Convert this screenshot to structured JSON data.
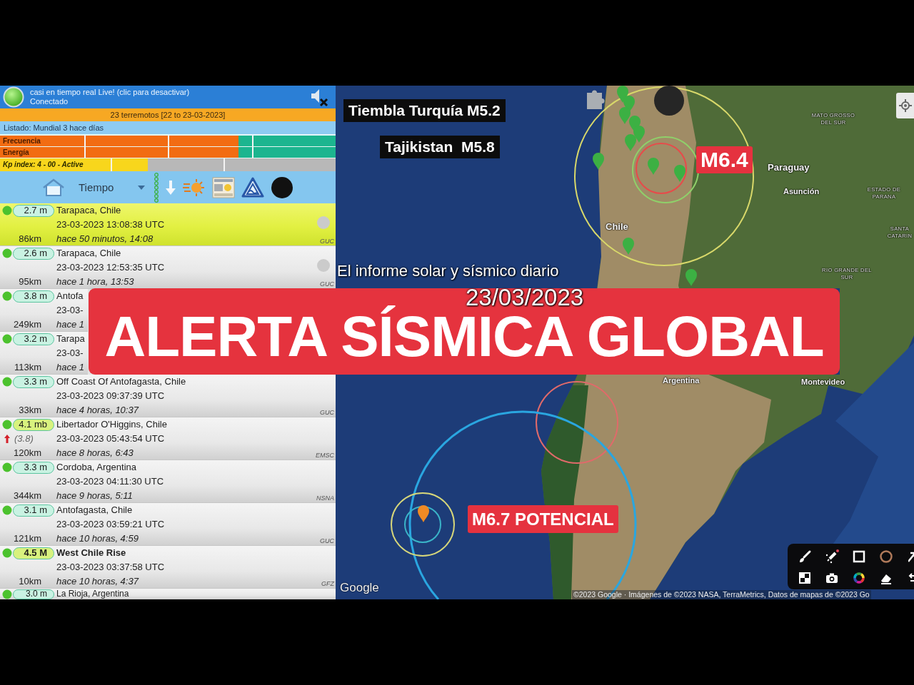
{
  "live_header": {
    "status_text": "casi en tiempo real Live! (clic para desactivar)",
    "connection": "Conectado",
    "connected": true,
    "sound_muted": true
  },
  "summary": "23 terremotos [22 to 23-03-2023]",
  "listing": "Listado: Mundial 3 hace días",
  "meters": [
    {
      "label": "Frecuencia",
      "level": 0.71
    },
    {
      "label": "Energía",
      "level": 0.71
    }
  ],
  "kp_index": {
    "label": "Kp index: 4 - 00 - Active",
    "level": 0.44
  },
  "toolbar": {
    "sort_label": "Tiempo"
  },
  "quakes": [
    {
      "magnitude": "2.7 m",
      "place": "Tarapaca, Chile",
      "time": "23-03-2023 13:08:38 UTC",
      "distance": "86km",
      "ago": "hace 50 minutos, 14:08",
      "source": "GUC",
      "indicator": true,
      "selected": true,
      "bold": false,
      "color": "#c9f2e2"
    },
    {
      "magnitude": "2.6 m",
      "place": "Tarapaca, Chile",
      "time": "23-03-2023 12:53:35 UTC",
      "distance": "95km",
      "ago": "hace 1 hora, 13:53",
      "source": "GUC",
      "indicator": true,
      "selected": false,
      "bold": false,
      "color": "#c9f2e2"
    },
    {
      "magnitude": "3.8 m",
      "place": "Antofa",
      "time": "23-03-",
      "distance": "249km",
      "ago": "hace 1",
      "indicator": false,
      "selected": false,
      "bold": false,
      "color": "#c9f2e2"
    },
    {
      "magnitude": "3.2 m",
      "place": "Tarapa",
      "time": "23-03-",
      "distance": "113km",
      "ago": "hace 1",
      "indicator": false,
      "selected": false,
      "bold": false,
      "color": "#c9f2e2"
    },
    {
      "magnitude": "3.3 m",
      "place": "Off Coast Of Antofagasta, Chile",
      "time": "23-03-2023 09:37:39 UTC",
      "distance": "33km",
      "ago": "hace 4 horas, 10:37",
      "source": "GUC",
      "indicator": false,
      "selected": false,
      "bold": false,
      "color": "#c9f2e2"
    },
    {
      "magnitude": "4.1 mb",
      "place": "Libertador O'Higgins, Chile",
      "alt_magnitude": "(3.8)",
      "time": "23-03-2023 05:43:54 UTC",
      "distance": "120km",
      "ago": "hace 8 horas, 6:43",
      "source": "EMSC",
      "indicator": false,
      "selected": false,
      "bold": false,
      "color": "#d8f27e"
    },
    {
      "magnitude": "3.3 m",
      "place": "Cordoba, Argentina",
      "time": "23-03-2023 04:11:30 UTC",
      "distance": "344km",
      "ago": "hace 9 horas, 5:11",
      "source": "NSNA",
      "indicator": false,
      "selected": false,
      "bold": false,
      "color": "#c9f2e2"
    },
    {
      "magnitude": "3.1 m",
      "place": "Antofagasta, Chile",
      "time": "23-03-2023 03:59:21 UTC",
      "distance": "121km",
      "ago": "hace 10 horas, 4:59",
      "source": "GUC",
      "indicator": false,
      "selected": false,
      "bold": false,
      "color": "#c9f2e2"
    },
    {
      "magnitude": "4.5 M",
      "place": "West Chile Rise",
      "time": "23-03-2023 03:37:58 UTC",
      "distance": "10km",
      "ago": "hace 10 horas, 4:37",
      "source": "GFZ",
      "indicator": false,
      "selected": false,
      "bold": true,
      "color": "#d8f27e"
    },
    {
      "magnitude": "3.0 m",
      "place": "La Rioja, Argentina",
      "selected": false,
      "bold": false,
      "color": "#c9f2e2"
    }
  ],
  "map": {
    "labels": [
      "Chile",
      "Paraguay",
      "Asunción",
      "MATO GROSSO DEL SUR",
      "ESTADO DE PARANA",
      "SANTA CATARIN",
      "RIO GRANDE DEL SUR",
      "Argentina",
      "Montevideo"
    ],
    "logo": "Google",
    "attribution": "©2023 Google · Imágenes de ©2023 NASA, TerraMetrics, Datos de mapas de ©2023 Go",
    "circles": [
      {
        "color": "#d8d86a"
      },
      {
        "color": "#8fd06a"
      },
      {
        "color": "#e84a4a"
      },
      {
        "color": "#e06a6a"
      },
      {
        "color": "#2aa6e0"
      },
      {
        "color": "#d6d67a"
      },
      {
        "color": "#3ab4c8"
      }
    ],
    "pins": [
      {
        "color": "#3cb043"
      },
      {
        "color": "#3cb043"
      },
      {
        "color": "#3cb043"
      },
      {
        "color": "#3cb043"
      },
      {
        "color": "#3cb043"
      },
      {
        "color": "#3cb043"
      },
      {
        "color": "#3cb043"
      },
      {
        "color": "#3cb043"
      },
      {
        "color": "#3cb043"
      },
      {
        "color": "#3cb043"
      },
      {
        "color": "#3cb043"
      },
      {
        "color": "#f08a24"
      }
    ]
  },
  "overlays": {
    "headlines": [
      "Tiembla Turquía M5.2",
      "Tajikistan  M5.8"
    ],
    "subtitle": "El informe solar y sísmico diario",
    "date": "23/03/2023",
    "banner": "ALERTA SÍSMICA GLOBAL",
    "tags": [
      "M6.4",
      "M6.7 POTENCIAL"
    ]
  }
}
